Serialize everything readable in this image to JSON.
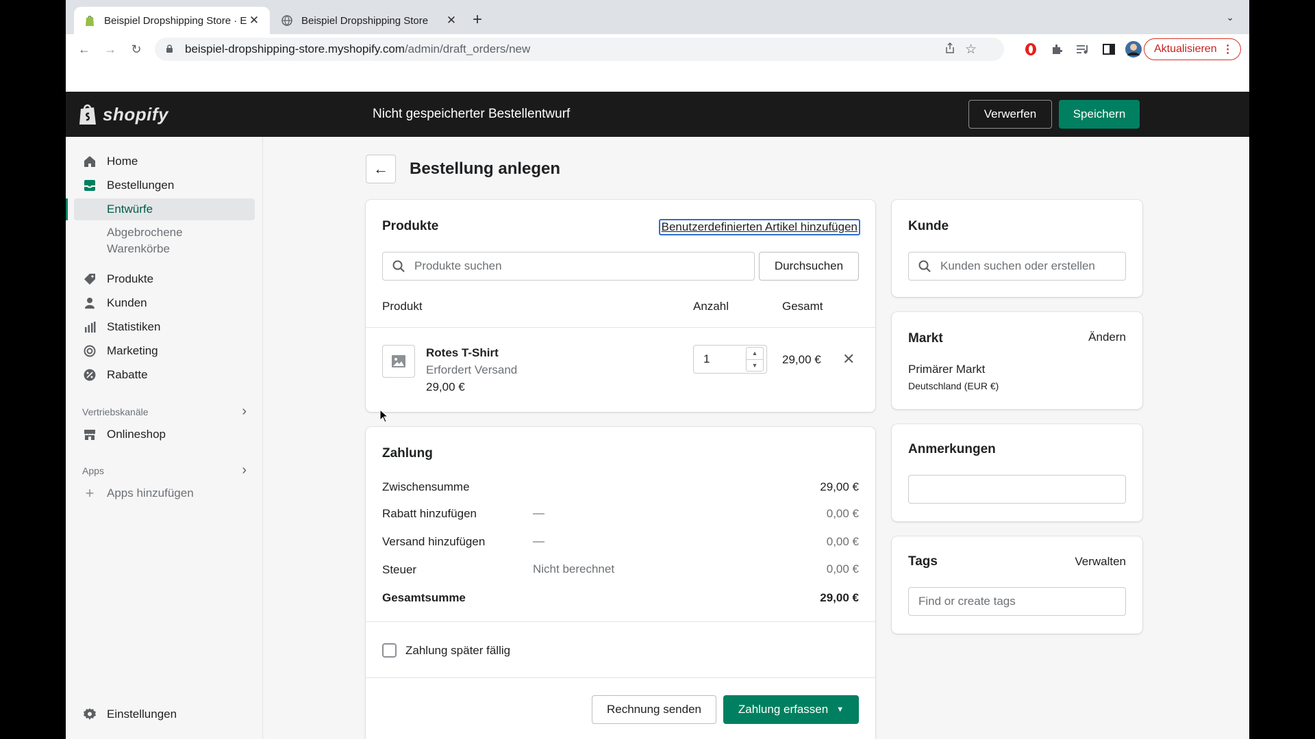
{
  "browser": {
    "tabs": [
      {
        "title": "Beispiel Dropshipping Store · E",
        "active": true
      },
      {
        "title": "Beispiel Dropshipping Store",
        "active": false
      }
    ],
    "url_host": "beispiel-dropshipping-store.myshopify.com",
    "url_path": "/admin/draft_orders/new",
    "update_label": "Aktualisieren"
  },
  "topbar": {
    "logo_text": "shopify",
    "title": "Nicht gespeicherter Bestellentwurf",
    "discard_label": "Verwerfen",
    "save_label": "Speichern"
  },
  "sidebar": {
    "home": "Home",
    "orders": "Bestellungen",
    "drafts": "Entwürfe",
    "abandoned_line1": "Abgebrochene",
    "abandoned_line2": "Warenkörbe",
    "products": "Produkte",
    "customers": "Kunden",
    "analytics": "Statistiken",
    "marketing": "Marketing",
    "discounts": "Rabatte",
    "sales_channels": "Vertriebskanäle",
    "online_store": "Onlineshop",
    "apps": "Apps",
    "add_apps": "Apps hinzufügen",
    "settings": "Einstellungen"
  },
  "page": {
    "title": "Bestellung anlegen"
  },
  "products_card": {
    "title": "Produkte",
    "custom_item_link": "Benutzerdefinierten Artikel hinzufügen",
    "search_placeholder": "Produkte suchen",
    "browse_label": "Durchsuchen",
    "col_product": "Produkt",
    "col_qty": "Anzahl",
    "col_total": "Gesamt",
    "item": {
      "name": "Rotes T-Shirt",
      "shipping": "Erfordert Versand",
      "price": "29,00 €",
      "quantity": "1",
      "total": "29,00 €"
    }
  },
  "payment_card": {
    "title": "Zahlung",
    "subtotal_label": "Zwischensumme",
    "subtotal_value": "29,00 €",
    "discount_label": "Rabatt hinzufügen",
    "discount_dash": "—",
    "discount_value": "0,00 €",
    "shipping_label": "Versand hinzufügen",
    "shipping_dash": "—",
    "shipping_value": "0,00 €",
    "tax_label": "Steuer",
    "tax_note": "Nicht berechnet",
    "tax_value": "0,00 €",
    "total_label": "Gesamtsumme",
    "total_value": "29,00 €",
    "pay_later_label": "Zahlung später fällig",
    "send_invoice_label": "Rechnung senden",
    "collect_payment_label": "Zahlung erfassen"
  },
  "customer_card": {
    "title": "Kunde",
    "search_placeholder": "Kunden suchen oder erstellen"
  },
  "market_card": {
    "title": "Markt",
    "change_label": "Ändern",
    "primary": "Primärer Markt",
    "country": "Deutschland (EUR €)"
  },
  "notes_card": {
    "title": "Anmerkungen"
  },
  "tags_card": {
    "title": "Tags",
    "manage_label": "Verwalten",
    "placeholder": "Find or create tags"
  },
  "colors": {
    "brand_green": "#008060",
    "link_blue": "#2c6ecb",
    "topbar_bg": "#1a1a1a"
  }
}
